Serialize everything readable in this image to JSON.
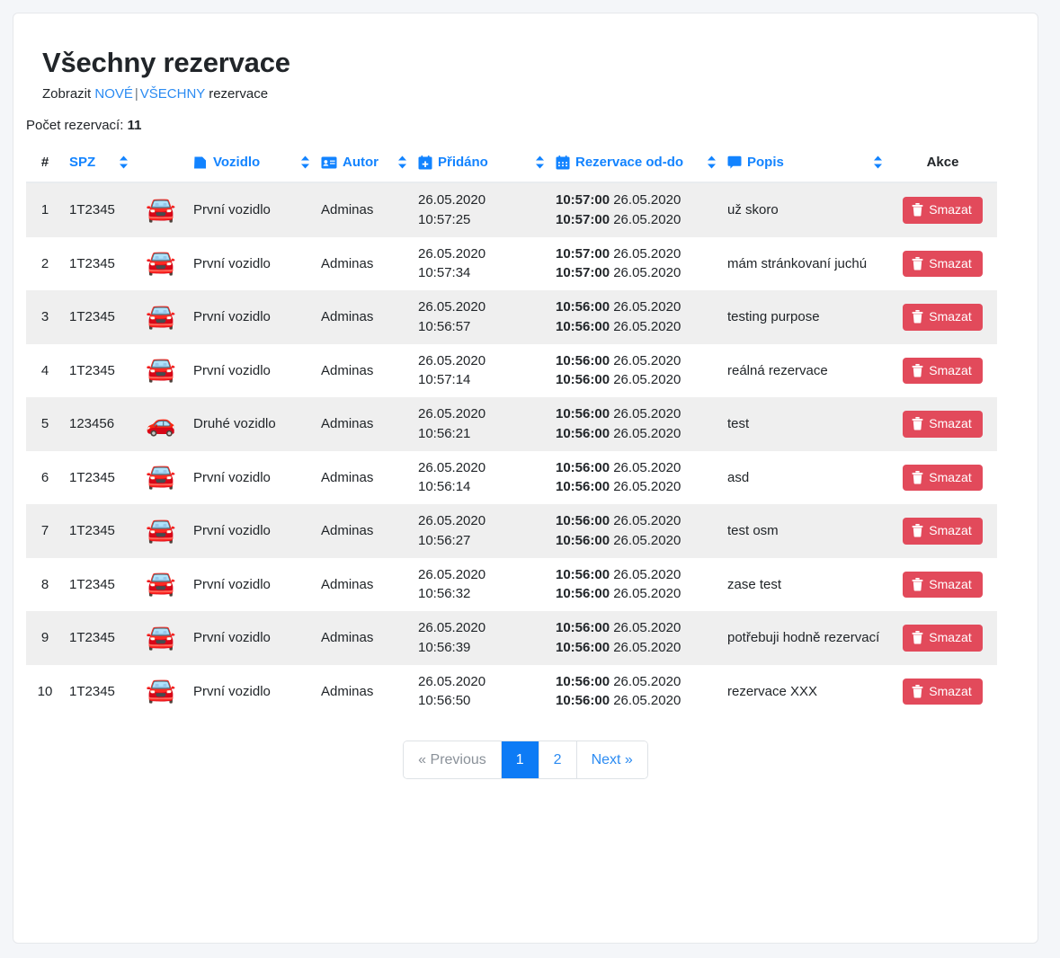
{
  "header": {
    "title": "Všechny rezervace",
    "subline_prefix": "Zobrazit",
    "link_new": "NOVÉ",
    "separator": "|",
    "link_all": "VŠECHNY",
    "subline_suffix": "rezervace",
    "count_label": "Počet rezervací:",
    "count_value": "11"
  },
  "colors": {
    "header_link": "#1283ff",
    "link": "#2b8bf2",
    "danger": "#e24a5b",
    "active_page": "#0d7bf5",
    "row_odd": "#efefef",
    "row_even": "#ffffff"
  },
  "table": {
    "columns": [
      {
        "key": "num",
        "label": "#",
        "icon": "",
        "sortable": false
      },
      {
        "key": "spz",
        "label": "SPZ",
        "icon": "",
        "sortable": true
      },
      {
        "key": "car",
        "label": "",
        "icon": "",
        "sortable": false
      },
      {
        "key": "voz",
        "label": "Vozidlo",
        "icon": "file-icon",
        "sortable": true
      },
      {
        "key": "aut",
        "label": "Autor",
        "icon": "id-card-icon",
        "sortable": true
      },
      {
        "key": "pri",
        "label": "Přidáno",
        "icon": "calendar-plus-icon",
        "sortable": true
      },
      {
        "key": "rez",
        "label": "Rezervace od-do",
        "icon": "calendar-icon",
        "sortable": true
      },
      {
        "key": "pop",
        "label": "Popis",
        "icon": "comment-icon",
        "sortable": true
      },
      {
        "key": "akc",
        "label": "Akce",
        "icon": "",
        "sortable": false
      }
    ],
    "delete_label": "Smazat",
    "rows": [
      {
        "num": "1",
        "spz": "1T2345",
        "car_color": "blue",
        "vozidlo": "První vozidlo",
        "autor": "Adminas",
        "pridano_date": "26.05.2020",
        "pridano_time": "10:57:25",
        "od_time": "10:57:00",
        "od_date": "26.05.2020",
        "do_time": "10:57:00",
        "do_date": "26.05.2020",
        "popis": "už skoro"
      },
      {
        "num": "2",
        "spz": "1T2345",
        "car_color": "blue",
        "vozidlo": "První vozidlo",
        "autor": "Adminas",
        "pridano_date": "26.05.2020",
        "pridano_time": "10:57:34",
        "od_time": "10:57:00",
        "od_date": "26.05.2020",
        "do_time": "10:57:00",
        "do_date": "26.05.2020",
        "popis": "mám stránkovaní juchú"
      },
      {
        "num": "3",
        "spz": "1T2345",
        "car_color": "blue",
        "vozidlo": "První vozidlo",
        "autor": "Adminas",
        "pridano_date": "26.05.2020",
        "pridano_time": "10:56:57",
        "od_time": "10:56:00",
        "od_date": "26.05.2020",
        "do_time": "10:56:00",
        "do_date": "26.05.2020",
        "popis": "testing purpose"
      },
      {
        "num": "4",
        "spz": "1T2345",
        "car_color": "blue",
        "vozidlo": "První vozidlo",
        "autor": "Adminas",
        "pridano_date": "26.05.2020",
        "pridano_time": "10:57:14",
        "od_time": "10:56:00",
        "od_date": "26.05.2020",
        "do_time": "10:56:00",
        "do_date": "26.05.2020",
        "popis": "reálná rezervace"
      },
      {
        "num": "5",
        "spz": "123456",
        "car_color": "red",
        "vozidlo": "Druhé vozidlo",
        "autor": "Adminas",
        "pridano_date": "26.05.2020",
        "pridano_time": "10:56:21",
        "od_time": "10:56:00",
        "od_date": "26.05.2020",
        "do_time": "10:56:00",
        "do_date": "26.05.2020",
        "popis": "test"
      },
      {
        "num": "6",
        "spz": "1T2345",
        "car_color": "blue",
        "vozidlo": "První vozidlo",
        "autor": "Adminas",
        "pridano_date": "26.05.2020",
        "pridano_time": "10:56:14",
        "od_time": "10:56:00",
        "od_date": "26.05.2020",
        "do_time": "10:56:00",
        "do_date": "26.05.2020",
        "popis": "asd"
      },
      {
        "num": "7",
        "spz": "1T2345",
        "car_color": "blue",
        "vozidlo": "První vozidlo",
        "autor": "Adminas",
        "pridano_date": "26.05.2020",
        "pridano_time": "10:56:27",
        "od_time": "10:56:00",
        "od_date": "26.05.2020",
        "do_time": "10:56:00",
        "do_date": "26.05.2020",
        "popis": "test osm"
      },
      {
        "num": "8",
        "spz": "1T2345",
        "car_color": "blue",
        "vozidlo": "První vozidlo",
        "autor": "Adminas",
        "pridano_date": "26.05.2020",
        "pridano_time": "10:56:32",
        "od_time": "10:56:00",
        "od_date": "26.05.2020",
        "do_time": "10:56:00",
        "do_date": "26.05.2020",
        "popis": "zase test"
      },
      {
        "num": "9",
        "spz": "1T2345",
        "car_color": "blue",
        "vozidlo": "První vozidlo",
        "autor": "Adminas",
        "pridano_date": "26.05.2020",
        "pridano_time": "10:56:39",
        "od_time": "10:56:00",
        "od_date": "26.05.2020",
        "do_time": "10:56:00",
        "do_date": "26.05.2020",
        "popis": "potřebuji hodně rezervací"
      },
      {
        "num": "10",
        "spz": "1T2345",
        "car_color": "blue",
        "vozidlo": "První vozidlo",
        "autor": "Adminas",
        "pridano_date": "26.05.2020",
        "pridano_time": "10:56:50",
        "od_time": "10:56:00",
        "od_date": "26.05.2020",
        "do_time": "10:56:00",
        "do_date": "26.05.2020",
        "popis": "rezervace XXX"
      }
    ]
  },
  "pagination": {
    "previous": "« Previous",
    "pages": [
      "1",
      "2"
    ],
    "active_page": "1",
    "next": "Next »"
  }
}
